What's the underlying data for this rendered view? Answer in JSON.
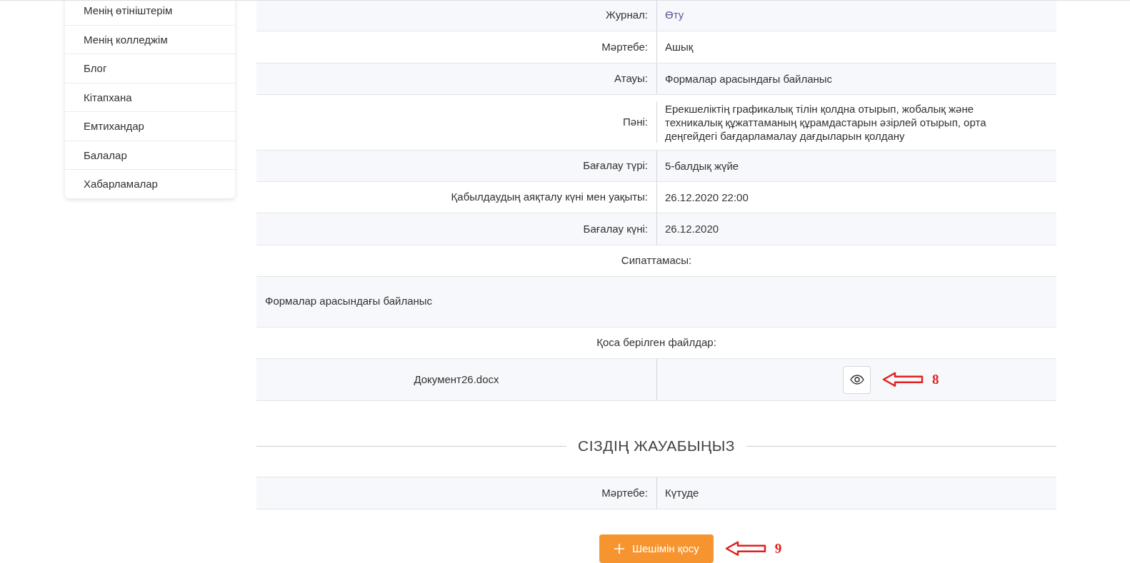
{
  "sidebar": {
    "items": [
      {
        "label": "Менің өтініштерім"
      },
      {
        "label": "Менің колледжім"
      },
      {
        "label": "Блог"
      },
      {
        "label": "Кітапхана"
      },
      {
        "label": "Емтихандар"
      },
      {
        "label": "Балалар"
      },
      {
        "label": "Хабарламалар"
      }
    ]
  },
  "details": {
    "rows": [
      {
        "label": "Журнал:",
        "value": "Өту",
        "kind": "link"
      },
      {
        "label": "Мәртебе:",
        "value": "Ашық",
        "kind": "text"
      },
      {
        "label": "Атауы:",
        "value": "Формалар арасындағы байланыс",
        "kind": "text"
      },
      {
        "label": "Пәні:",
        "value": "Ерекшеліктің графикалық тілін қолдна отырып, жобалық және техникалық құжаттаманың құрамдастарын әзірлей отырып, орта деңгейдегі бағдарламалау дағдыларын қолдану",
        "kind": "text"
      },
      {
        "label": "Бағалау түрі:",
        "value": "5-балдық жүйе",
        "kind": "text"
      },
      {
        "label": "Қабылдаудың аяқталу күні мен уақыты:",
        "value": "26.12.2020 22:00",
        "kind": "text"
      },
      {
        "label": "Бағалау күні:",
        "value": "26.12.2020",
        "kind": "text"
      }
    ]
  },
  "description": {
    "heading": "Сипаттамасы:",
    "text": "Формалар арасындағы байланыс"
  },
  "attachments": {
    "heading": "Қоса берілген файлдар:",
    "files": [
      {
        "name": "Документ26.docx",
        "callout": "8"
      }
    ]
  },
  "answer": {
    "heading": "СІЗДІҢ ЖАУАБЫҢЫЗ",
    "rows": [
      {
        "label": "Мәртебе:",
        "value": "Күтуде"
      }
    ]
  },
  "add_button": {
    "label": "Шешімін қосу",
    "callout": "9"
  }
}
